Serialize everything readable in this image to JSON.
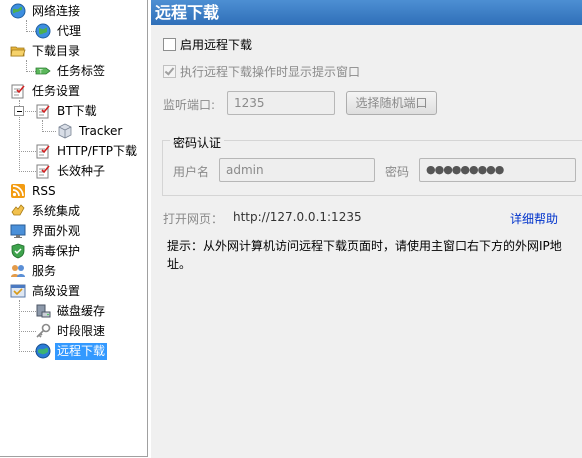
{
  "tree": {
    "items": [
      {
        "label": "网络连接",
        "icon": "globe-network-icon"
      },
      {
        "label": "代理",
        "icon": "globe-proxy-icon"
      },
      {
        "label": "下载目录",
        "icon": "folder-open-icon"
      },
      {
        "label": "任务标签",
        "icon": "tag-icon"
      },
      {
        "label": "任务设置",
        "icon": "task-checklist-icon"
      },
      {
        "label": "BT下载",
        "icon": "task-checklist-icon"
      },
      {
        "label": "Tracker",
        "icon": "cube-icon"
      },
      {
        "label": "HTTP/FTP下载",
        "icon": "task-checklist-icon"
      },
      {
        "label": "长效种子",
        "icon": "task-checklist-icon"
      },
      {
        "label": "RSS",
        "icon": "rss-icon"
      },
      {
        "label": "系统集成",
        "icon": "hand-integration-icon"
      },
      {
        "label": "界面外观",
        "icon": "monitor-icon"
      },
      {
        "label": "病毒保护",
        "icon": "shield-icon"
      },
      {
        "label": "服务",
        "icon": "people-icon"
      },
      {
        "label": "高级设置",
        "icon": "advanced-settings-icon"
      },
      {
        "label": "磁盘缓存",
        "icon": "disk-cache-icon"
      },
      {
        "label": "时段限速",
        "icon": "key-icon"
      },
      {
        "label": "远程下载",
        "icon": "globe-remote-icon"
      }
    ]
  },
  "panel": {
    "title": "远程下载",
    "enable_remote": {
      "label": "启用远程下载",
      "checked": false
    },
    "show_prompt": {
      "label": "执行远程下载操作时显示提示窗口",
      "checked": true,
      "disabled": true
    },
    "port_label": "监听端口:",
    "port_value": "1235",
    "random_port_button": "选择随机端口",
    "auth_group_title": "密码认证",
    "username_label": "用户名",
    "username_value": "admin",
    "password_label": "密码",
    "password_value": "●●●●●●●●●",
    "open_page_label": "打开网页：",
    "open_page_url": "http://127.0.0.1:1235",
    "help_link": "详细帮助",
    "tip": "提示：从外网计算机访问远程下载页面时，请使用主窗口右下方的外网IP地址。"
  },
  "colors": {
    "title_bar": "#3a7cc4",
    "selection": "#3399ff",
    "panel_bg": "#f0f0f0",
    "link": "#0033cc"
  }
}
